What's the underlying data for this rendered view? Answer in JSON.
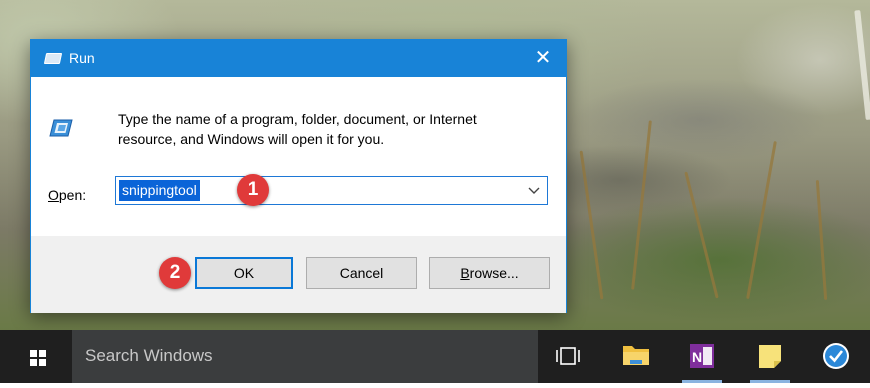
{
  "dialog": {
    "title": "Run",
    "close_glyph": "✕",
    "prompt_line1": "Type the name of a program, folder, document, or Internet",
    "prompt_line2": "resource, and Windows will open it for you.",
    "open_label_accel": "O",
    "open_label_rest": "pen:",
    "open_value": "snippingtool",
    "buttons": {
      "ok": "OK",
      "cancel": "Cancel",
      "browse_accel": "B",
      "browse_rest": "rowse..."
    }
  },
  "annotations": {
    "step1": "1",
    "step2": "2",
    "badge_color": "#e03a3a"
  },
  "taskbar": {
    "search_placeholder": "Search Windows",
    "icons": [
      "task-view-icon",
      "file-explorer-icon",
      "onenote-icon",
      "sticky-notes-icon",
      "wunderlist-icon"
    ]
  },
  "colors": {
    "accent": "#1883d7",
    "taskbar": "#1f1f1f",
    "search_box": "#3b3d3e"
  }
}
